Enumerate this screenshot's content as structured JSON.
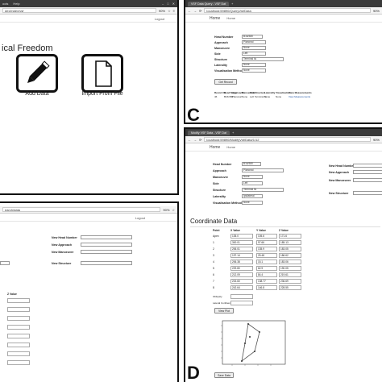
{
  "panelA": {
    "menu": [
      "ools",
      "Help"
    ],
    "url": "dex/index/vsf",
    "zoom": "90%",
    "logout": "Logout",
    "heading": "ical Freedom",
    "add_label": "Add Data",
    "import_label": "Import From File"
  },
  "panelB": {
    "url": "earch/data",
    "zoom": "90%",
    "logout": "Logout",
    "fields": [
      "New Head Number",
      "New Approach",
      "New Manoeuvre",
      "New Structure"
    ],
    "z_header": "Z Value"
  },
  "panelC": {
    "tab": "VSF Data Query - VSF Dat",
    "url": "localhost:59890/QueryVsf/Data",
    "zoom": "90%",
    "nav": [
      "Home",
      "Home"
    ],
    "fields": [
      {
        "label": "Head Number",
        "value": "B16/380"
      },
      {
        "label": "Approach",
        "value": "Planonal"
      },
      {
        "label": "Manoeuvre",
        "value": "None"
      },
      {
        "label": "Side",
        "value": "Left"
      },
      {
        "label": "Structure",
        "value": "Terminal Ilu"
      },
      {
        "label": "Laterality",
        "value": "None"
      },
      {
        "label": "Visualisation Method",
        "value": "None"
      }
    ],
    "get_button": "Get Record",
    "table_headers": [
      "Record ID",
      "Head Name",
      "Approach",
      "Manoeuvre",
      "Side",
      "Structure",
      "Laterality",
      "Visualisation",
      "View Measurements"
    ],
    "table_row": [
      "46",
      "B16/380",
      "Planonal",
      "None",
      "Left",
      "Terminal Iu",
      "None",
      "None",
      "View Measurements"
    ],
    "letter": "C"
  },
  "panelD": {
    "tab": "Modify VSF Data - VSF Dat",
    "url": "localhost:59890/ModifyVsf/Data/1/12",
    "zoom": "90%",
    "nav": [
      "Home",
      "Home"
    ],
    "fields": [
      {
        "label": "Head Number",
        "value": "B16/380"
      },
      {
        "label": "Approach",
        "value": "Planonal"
      },
      {
        "label": "Manoeuvre",
        "value": "None"
      },
      {
        "label": "Side",
        "value": "Left"
      },
      {
        "label": "Structure",
        "value": "Terminal Ilu"
      },
      {
        "label": "Laterality",
        "value": "Ipsilateral"
      },
      {
        "label": "Visualisation Method",
        "value": "None"
      }
    ],
    "right_fields": [
      "New Head Number",
      "New Approach",
      "New Manoeuvre",
      "New Structure"
    ],
    "coord_title": "Coordinate Data",
    "coord_headers": [
      "Point",
      "X Value",
      "Y Value",
      "Z Value"
    ],
    "coords": [
      {
        "point": "Apex",
        "x": "135.0",
        "y": "105.6",
        "z": "171.6"
      },
      {
        "point": "1",
        "x": "300.01",
        "y": "97.66",
        "z": "185.13"
      },
      {
        "point": "2",
        "x": "206.01",
        "y": "135.9",
        "z": "183.05"
      },
      {
        "point": "3",
        "x": "197.14",
        "y": "25.48",
        "z": "186.62"
      },
      {
        "point": "4",
        "x": "206.38",
        "y": "15.1",
        "z": "183.06"
      },
      {
        "point": "5",
        "x": "229.80",
        "y": "62.9",
        "z": "190.05"
      },
      {
        "point": "6",
        "x": "212.09",
        "y": "84.4",
        "z": "219.61"
      },
      {
        "point": "7",
        "x": "215.60",
        "y": "138.77",
        "z": "236.69"
      },
      {
        "point": "8",
        "x": "242.64",
        "y": "146.8",
        "z": "228.55"
      }
    ],
    "extra_labels": [
      "Obliquity",
      "Lateral Confluence"
    ],
    "view_plot": "View Plot",
    "save_data": "Save Data",
    "letter": "D"
  }
}
